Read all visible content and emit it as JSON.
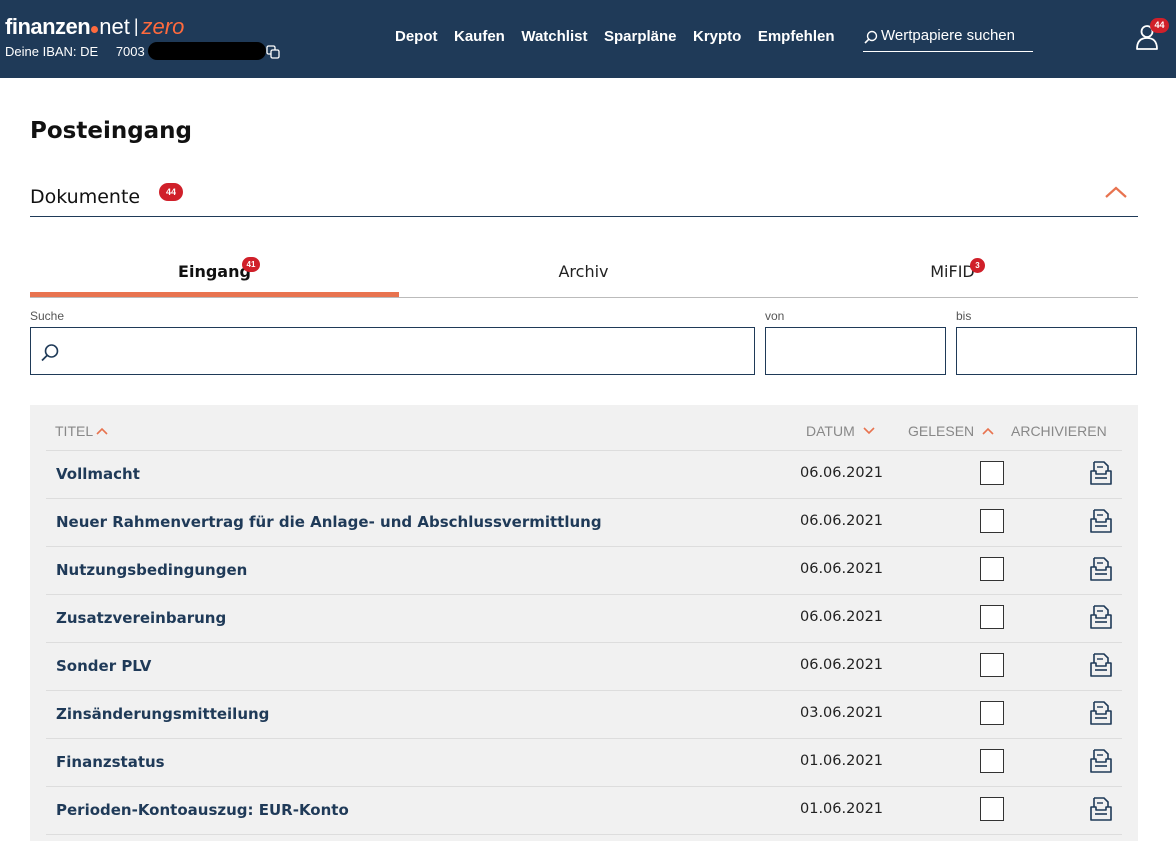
{
  "header": {
    "logo_brand": "finanzen",
    "logo_net": "net",
    "logo_sep": "|",
    "logo_zero": "zero",
    "iban_label": "Deine IBAN: DE",
    "iban_value": "7003",
    "nav": [
      "Depot",
      "Kaufen",
      "Watchlist",
      "Sparpläne",
      "Krypto",
      "Empfehlen"
    ],
    "search_placeholder": "Wertpapiere suchen",
    "user_badge": "44",
    "colors": {
      "bar": "#1f3a58",
      "accent": "#ff6a3d",
      "badge": "#d0202a"
    }
  },
  "page": {
    "title": "Posteingang",
    "section_title": "Dokumente",
    "section_badge": "44"
  },
  "tabs": [
    {
      "label": "Eingang",
      "badge": "41",
      "active": true
    },
    {
      "label": "Archiv",
      "badge": "",
      "active": false
    },
    {
      "label": "MiFID",
      "badge": "3",
      "active": false
    }
  ],
  "filters": {
    "search_label": "Suche",
    "search_value": "",
    "from_label": "von",
    "from_value": "",
    "to_label": "bis",
    "to_value": ""
  },
  "table": {
    "columns": [
      "Titel",
      "Datum",
      "Gelesen",
      "Archivieren"
    ],
    "rows": [
      {
        "title": "Vollmacht",
        "date": "06.06.2021",
        "read": false
      },
      {
        "title": "Neuer Rahmenvertrag für die Anlage- und Abschlussvermittlung",
        "date": "06.06.2021",
        "read": false
      },
      {
        "title": "Nutzungsbedingungen",
        "date": "06.06.2021",
        "read": false
      },
      {
        "title": "Zusatzvereinbarung",
        "date": "06.06.2021",
        "read": false
      },
      {
        "title": "Sonder PLV",
        "date": "06.06.2021",
        "read": false
      },
      {
        "title": "Zinsänderungsmitteilung",
        "date": "03.06.2021",
        "read": false
      },
      {
        "title": "Finanzstatus",
        "date": "01.06.2021",
        "read": false
      },
      {
        "title": "Perioden-Kontoauszug: EUR-Konto",
        "date": "01.06.2021",
        "read": false
      }
    ]
  },
  "icons": [
    "copy-icon",
    "search-icon",
    "user-icon",
    "chevron-up-icon",
    "sort-icon",
    "archive-icon"
  ]
}
